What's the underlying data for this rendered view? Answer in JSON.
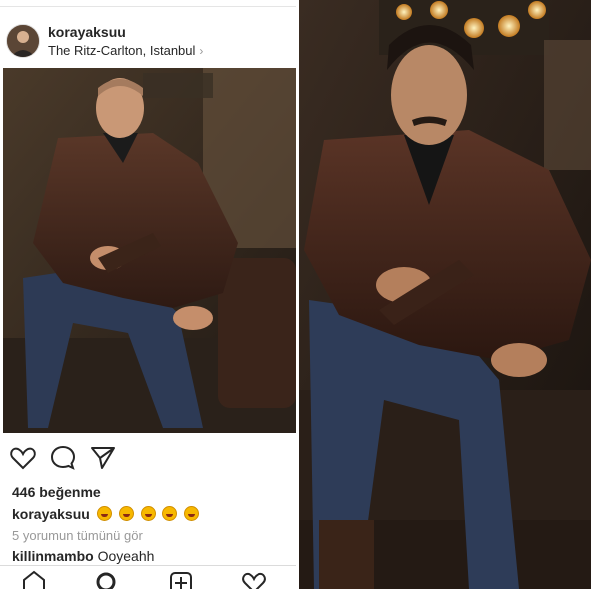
{
  "post": {
    "username": "korayaksuu",
    "location": "The Ritz-Carlton, Istanbul",
    "likes": "446 beğenme",
    "caption_user": "korayaksuu",
    "comments_link": "5 yorumun tümünü gör",
    "comment_user": "killinmambo",
    "comment_text": "Ooyeahh"
  },
  "icons": {
    "location_chevron": "chevron-right-icon",
    "like": "heart-icon",
    "comment": "comment-icon",
    "share": "send-icon",
    "home": "home-icon",
    "search": "search-icon",
    "add": "add-post-icon",
    "activity": "heart-icon"
  },
  "colors": {
    "text": "#262626",
    "muted": "#999999",
    "border": "#dbdbdb",
    "emoji": "#f7b800"
  }
}
